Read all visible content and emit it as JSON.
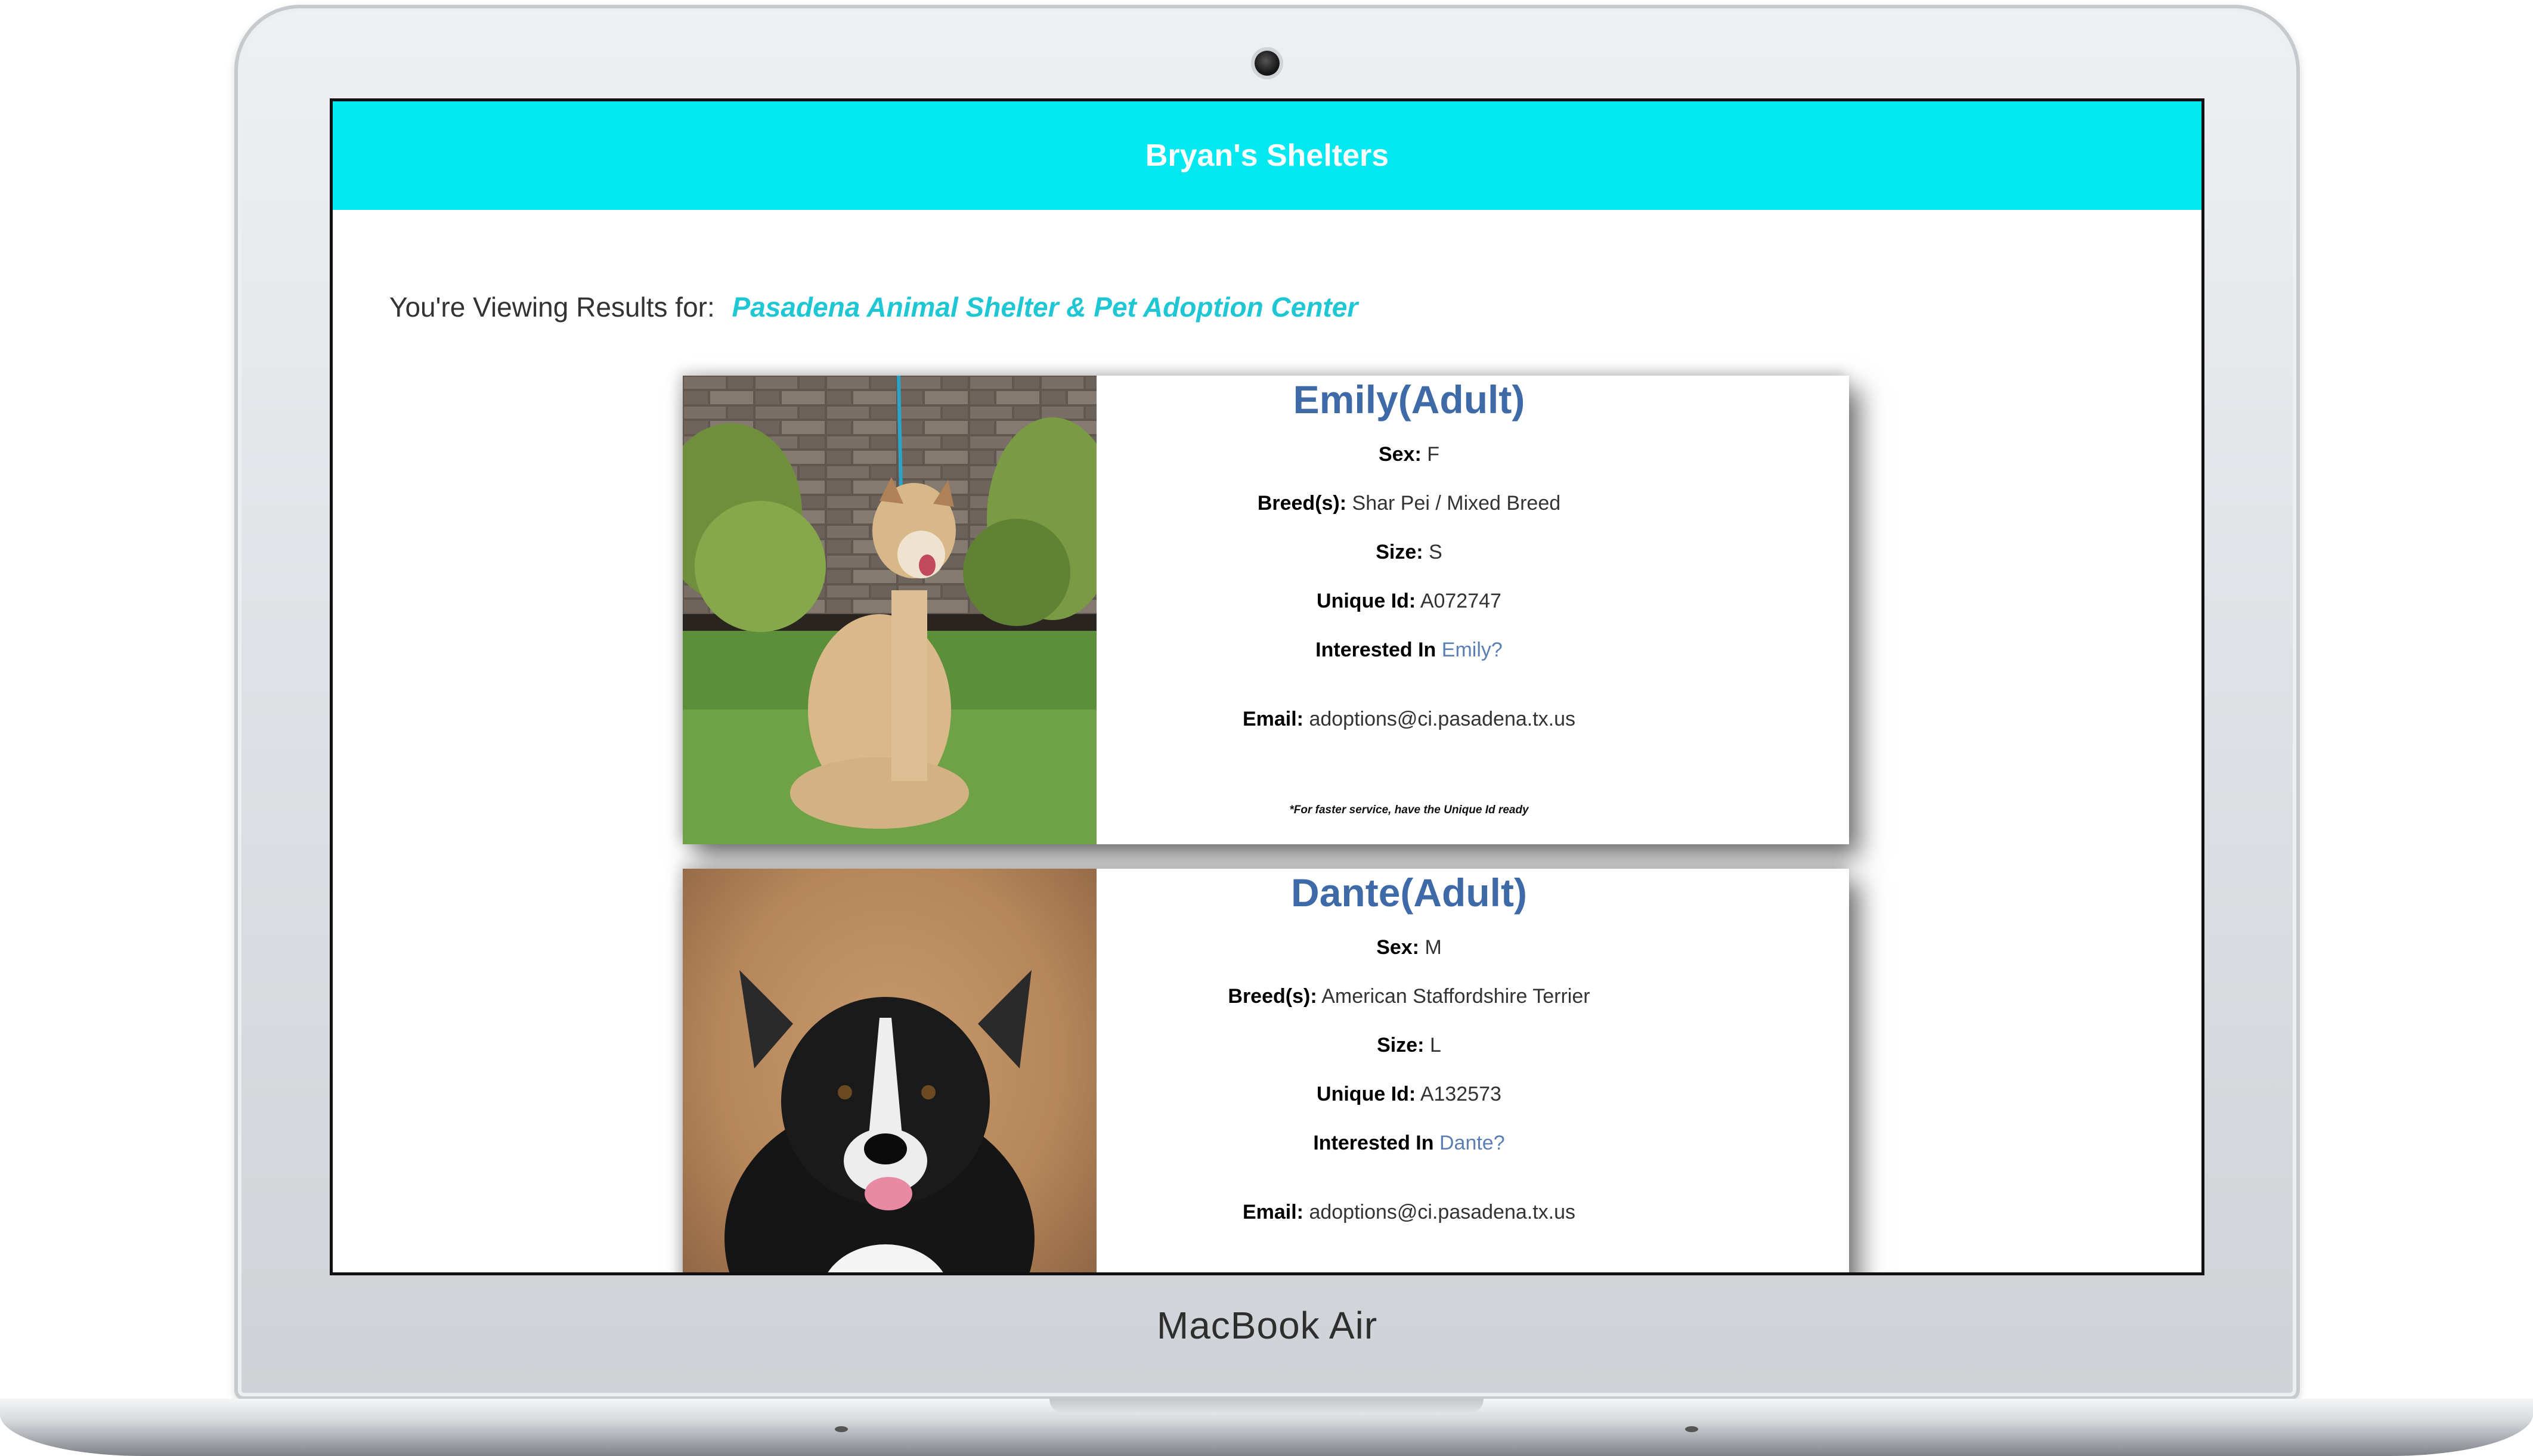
{
  "device": {
    "brand_label": "MacBook Air"
  },
  "site": {
    "title": "Bryan's Shelters",
    "results_prefix": "You're Viewing Results for:",
    "shelter_name": "Pasadena Animal Shelter & Pet Adoption Center"
  },
  "labels": {
    "sex": "Sex:",
    "breed": "Breed(s):",
    "size": "Size:",
    "unique_id": "Unique Id:",
    "interested": "Interested In",
    "email": "Email:",
    "note": "*For faster service, have the Unique Id ready"
  },
  "pets": [
    {
      "name": "Emily(Adult)",
      "sex": "F",
      "breed": "Shar Pei / Mixed Breed",
      "size": "S",
      "unique_id": "A072747",
      "interested_link": "Emily?",
      "email": "adoptions@ci.pasadena.tx.us"
    },
    {
      "name": "Dante(Adult)",
      "sex": "M",
      "breed": "American Staffordshire Terrier",
      "size": "L",
      "unique_id": "A132573",
      "interested_link": "Dante?",
      "email": "adoptions@ci.pasadena.tx.us"
    }
  ],
  "colors": {
    "header_bg": "#00e8f0",
    "accent": "#1fc6d4",
    "pet_name": "#3f6aa8",
    "link": "#5b7fb5"
  }
}
